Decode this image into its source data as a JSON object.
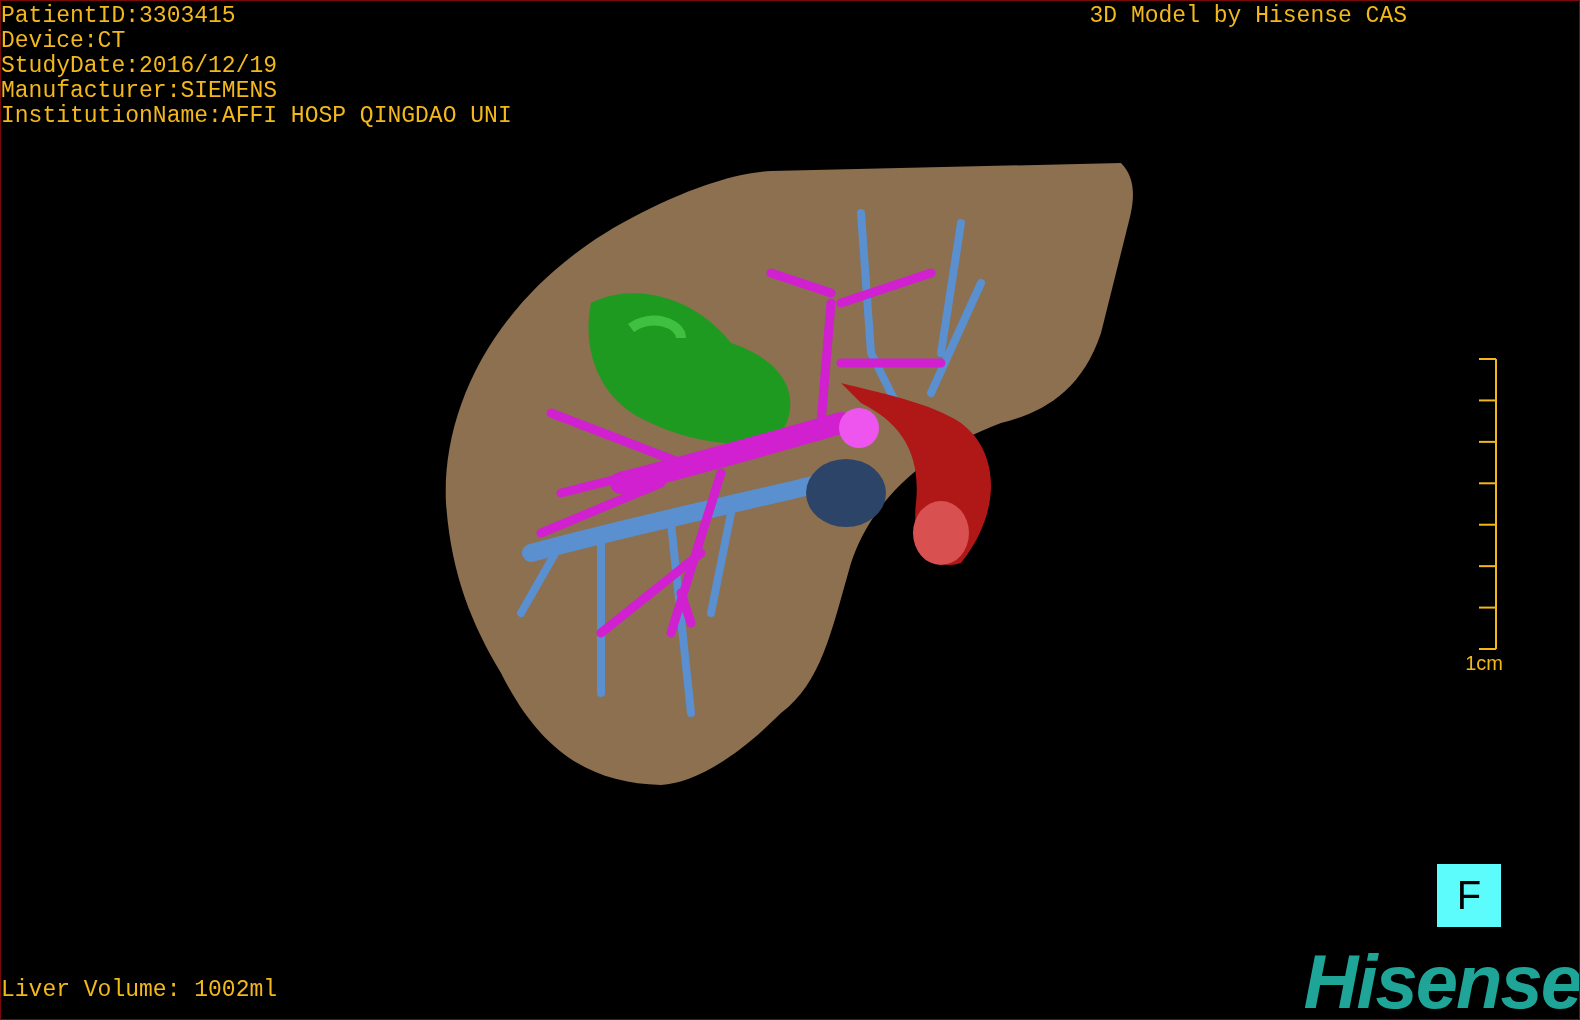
{
  "patient_info": [
    "PatientID:3303415",
    "Device:CT",
    "StudyDate:2016/12/19",
    "Manufacturer:SIEMENS",
    "InstitutionName:AFFI HOSP QINGDAO UNI"
  ],
  "title": "3D Model by Hisense CAS",
  "scale_bar": {
    "label": "1cm"
  },
  "view_button": {
    "label": "F"
  },
  "footer": {
    "volume": "Liver Volume: 1002ml"
  },
  "logo": {
    "text": "Hisense"
  }
}
